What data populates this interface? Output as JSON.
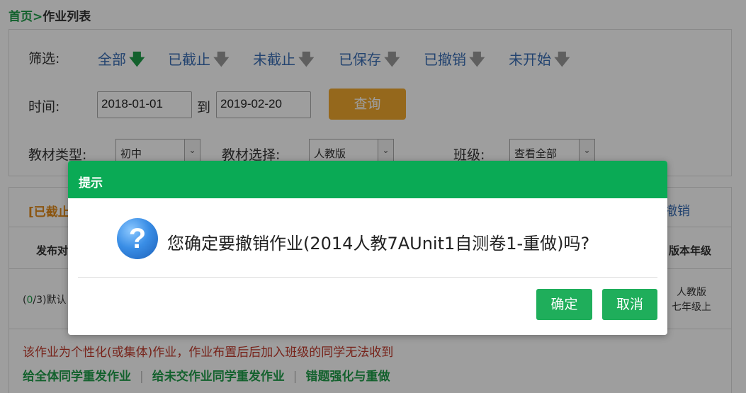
{
  "breadcrumb": {
    "home": "首页",
    "sep": ">",
    "current": "作业列表"
  },
  "filter": {
    "label": "筛选:",
    "options": [
      {
        "label": "全部",
        "arrow": "🡇",
        "active": true
      },
      {
        "label": "已截止",
        "arrow": "🡇",
        "active": false
      },
      {
        "label": "未截止",
        "arrow": "🡇",
        "active": false
      },
      {
        "label": "已保存",
        "arrow": "🡇",
        "active": false
      },
      {
        "label": "已撤销",
        "arrow": "🡇",
        "active": false
      },
      {
        "label": "未开始",
        "arrow": "🡇",
        "active": false
      }
    ]
  },
  "time": {
    "label": "时间:",
    "start": "2018-01-01",
    "to": "到",
    "end": "2019-02-20",
    "query": "查询"
  },
  "textbook_type": {
    "label": "教材类型:",
    "value": "初中"
  },
  "textbook_select": {
    "label": "教材选择:",
    "value": "人教版"
  },
  "class": {
    "label": "班级:",
    "value": "查看全部"
  },
  "list": {
    "status_tag": "[已截止",
    "revoke": "撤销",
    "col_publish": "发布对",
    "col_edition": "版本年级",
    "row_count_prefix": "(",
    "row_count_done": "0",
    "row_count_rest": "/3)默认",
    "row_edition_1": "人教版",
    "row_edition_2": "七年级上",
    "warning": "该作业为个性化(或集体)作业，作业布置后后加入班级的同学无法收到",
    "actions": [
      "给全体同学重发作业",
      "给未交作业同学重发作业",
      "错题强化与重做"
    ]
  },
  "dialog": {
    "title": "提示",
    "message": "您确定要撤销作业(2014人教7AUnit1自测卷1-重做)吗?",
    "icon": "question-icon",
    "ok": "确定",
    "cancel": "取消"
  },
  "colors": {
    "brand_green": "#0aaa55",
    "button_green": "#1fae5b",
    "query_orange": "#f0a92e",
    "link_blue": "#3a6fb5"
  }
}
